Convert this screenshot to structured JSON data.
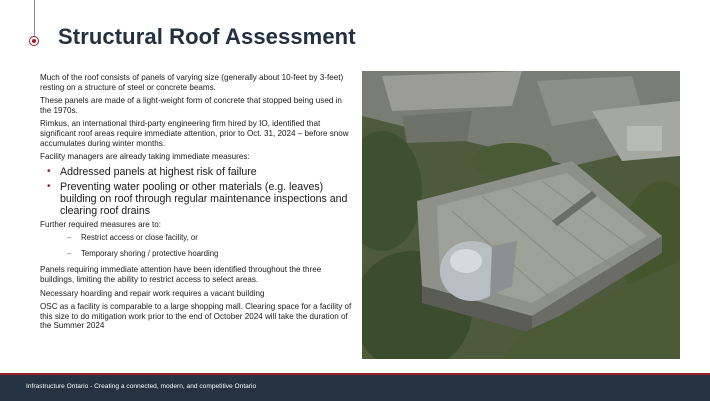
{
  "slide": {
    "title": "Structural Roof Assessment",
    "paragraphs": [
      "Much of the roof consists of panels of varying size (generally about 10-feet by 3-feet) resting on a structure of steel or concrete beams.",
      "These panels are made of a light-weight form of concrete that stopped being used in the 1970s.",
      "Rimkus, an international third-party engineering firm hired by IO, identified that significant roof areas require immediate attention, prior to Oct. 31, 2024 – before snow accumulates during winter months.",
      "Facility managers are already taking immediate measures:"
    ],
    "bullets": [
      "Addressed panels at highest risk of failure",
      "Preventing water pooling or other materials (e.g. leaves) building on roof through regular maintenance inspections and clearing roof drains"
    ],
    "further_heading": "Further required measures are to:",
    "sub_items": [
      "Restrict access or close facility, or",
      "Temporary shoring / protective hoarding"
    ],
    "closing_paragraphs": [
      "Panels requiring immediate attention have been identified throughout the three buildings, limiting the ability to restrict access to select areas.",
      "Necessary hoarding and repair work requires a vacant building",
      "OSC as a facility is comparable to a large shopping mall. Clearing space for a facility of this size to do mitigation work prior to the end of October 2024 will take the duration of the Summer 2024"
    ],
    "bullet_marker": "•",
    "dash_marker": "–"
  },
  "footer": {
    "text": "Infrastructure Ontario - Creating a connected, modern, and competitive Ontario"
  },
  "colors": {
    "accent": "#9a1d2c",
    "title": "#23303f",
    "footer_bg": "#243241"
  }
}
